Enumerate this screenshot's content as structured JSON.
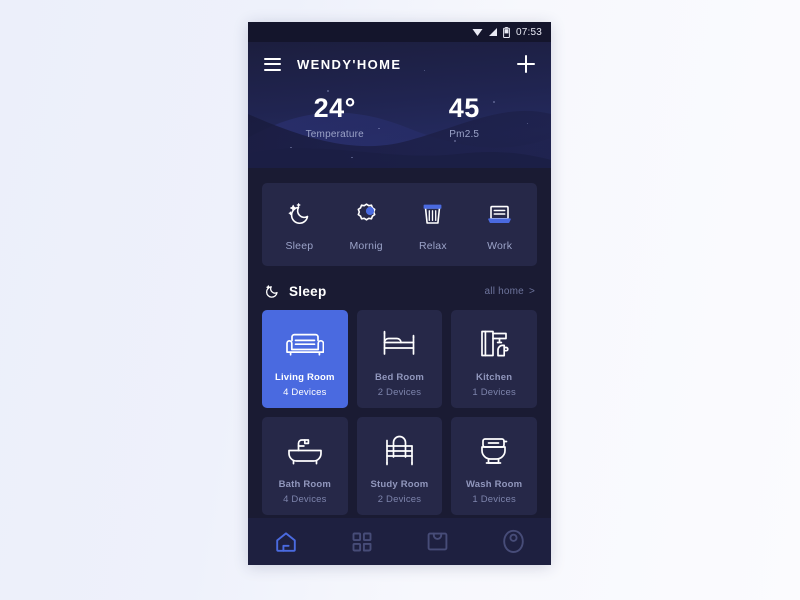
{
  "statusbar": {
    "time": "07:53",
    "icons": [
      "wifi-icon",
      "signal-icon",
      "battery-icon"
    ]
  },
  "appbar": {
    "menu_icon": "hamburger-menu-icon",
    "brand": "WENDY'HOME",
    "add_icon": "plus-icon"
  },
  "hero": {
    "metrics": [
      {
        "value": "24°",
        "label": "Temperature"
      },
      {
        "value": "45",
        "label": "Pm2.5"
      }
    ]
  },
  "modes": [
    {
      "label": "Sleep",
      "icon": "moon-stars-icon"
    },
    {
      "label": "Mornig",
      "icon": "sun-burst-icon"
    },
    {
      "label": "Relax",
      "icon": "cup-icon"
    },
    {
      "label": "Work",
      "icon": "laptop-icon"
    }
  ],
  "section": {
    "icon": "moon-icon",
    "title": "Sleep",
    "link_label": "all home",
    "link_chevron": ">"
  },
  "rooms": [
    {
      "name": "Living Room",
      "devices": "4 Devices",
      "icon": "sofa-icon",
      "active": true
    },
    {
      "name": "Bed Room",
      "devices": "2 Devices",
      "icon": "bed-icon",
      "active": false
    },
    {
      "name": "Kitchen",
      "devices": "1 Devices",
      "icon": "coffee-machine-icon",
      "active": false
    },
    {
      "name": "Bath Room",
      "devices": "4 Devices",
      "icon": "bathtub-icon",
      "active": false
    },
    {
      "name": "Study Room",
      "devices": "2 Devices",
      "icon": "desk-chair-icon",
      "active": false
    },
    {
      "name": "Wash Room",
      "devices": "1 Devices",
      "icon": "toilet-icon",
      "active": false
    }
  ],
  "bottomnav": [
    {
      "icon": "home-icon",
      "active": true
    },
    {
      "icon": "grid-apps-icon",
      "active": false
    },
    {
      "icon": "shopping-bag-icon",
      "active": false
    },
    {
      "icon": "profile-icon",
      "active": false
    }
  ],
  "colors": {
    "accent": "#4a6ae0",
    "card": "#262848",
    "screen_bg": "#1a1b33",
    "nav_bg": "#1e2040",
    "muted_text": "#9ba3c8",
    "page_bg": "#eef1fa"
  }
}
